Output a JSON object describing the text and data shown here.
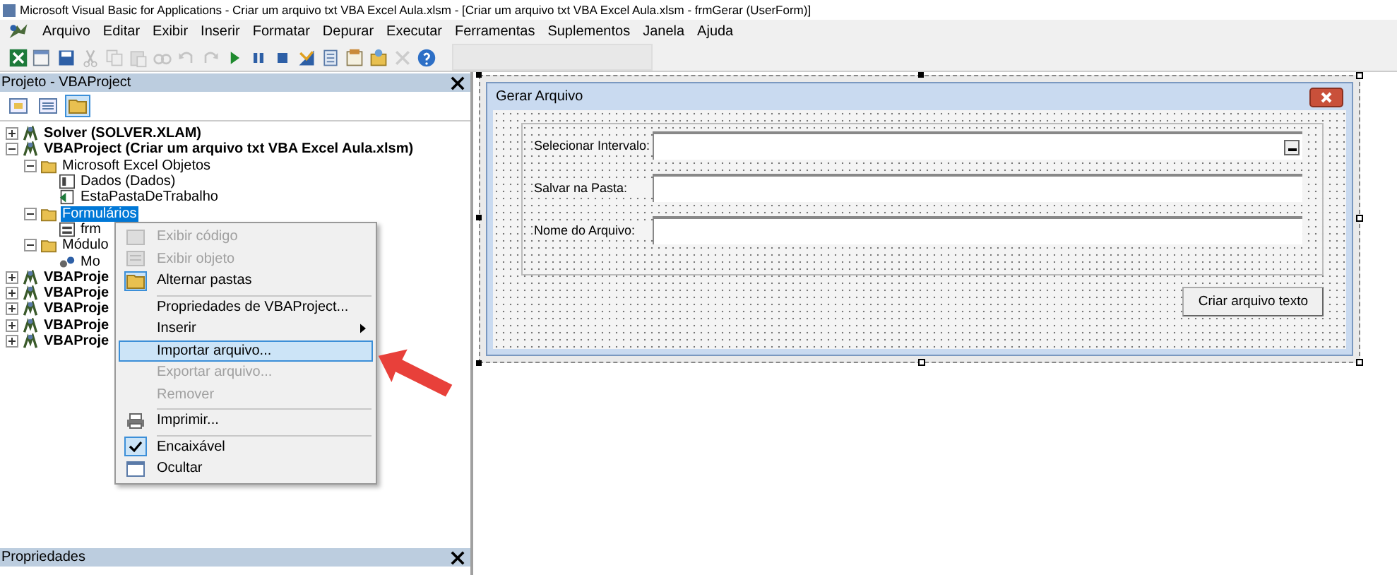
{
  "window": {
    "title": "Microsoft Visual Basic for Applications - Criar um arquivo txt VBA Excel Aula.xlsm - [Criar um arquivo txt VBA Excel Aula.xlsm - frmGerar (UserForm)]"
  },
  "menu_bar": [
    "Arquivo",
    "Editar",
    "Exibir",
    "Inserir",
    "Formatar",
    "Depurar",
    "Executar",
    "Ferramentas",
    "Suplementos",
    "Janela",
    "Ajuda"
  ],
  "toolbar": [
    {
      "kind": "excel",
      "disabled": false
    },
    {
      "kind": "insert",
      "disabled": false
    },
    {
      "kind": "save",
      "disabled": false
    },
    {
      "kind": "cut",
      "disabled": true
    },
    {
      "kind": "copy",
      "disabled": true
    },
    {
      "kind": "paste",
      "disabled": true
    },
    {
      "kind": "find",
      "disabled": true
    },
    {
      "kind": "undo",
      "disabled": true
    },
    {
      "kind": "redo",
      "disabled": true
    },
    {
      "kind": "run",
      "disabled": false
    },
    {
      "kind": "pause",
      "disabled": false
    },
    {
      "kind": "stop",
      "disabled": false
    },
    {
      "kind": "design",
      "disabled": false
    },
    {
      "kind": "explorer",
      "disabled": false
    },
    {
      "kind": "properties",
      "disabled": false
    },
    {
      "kind": "browser",
      "disabled": false
    },
    {
      "kind": "toolbox",
      "disabled": true
    },
    {
      "kind": "help",
      "disabled": false
    }
  ],
  "project_panel": {
    "title": "Projeto - VBAProject",
    "toolbar": [
      {
        "kind": "code",
        "selected": false
      },
      {
        "kind": "object",
        "selected": false
      },
      {
        "kind": "folders",
        "selected": true
      }
    ],
    "tree": [
      {
        "label": "Solver (SOLVER.XLAM)",
        "kind": "project",
        "expanded": false,
        "selected": false
      },
      {
        "label": "VBAProject (Criar um arquivo txt VBA Excel Aula.xlsm)",
        "kind": "project",
        "expanded": true,
        "selected": false,
        "children": [
          {
            "label": "Microsoft Excel Objetos",
            "kind": "folder",
            "expanded": true,
            "selected": false,
            "children": [
              {
                "label": "Dados (Dados)",
                "kind": "sheet",
                "selected": false
              },
              {
                "label": "EstaPastaDeTrabalho",
                "kind": "workbook",
                "selected": false
              }
            ]
          },
          {
            "label": "Formulários",
            "kind": "folder",
            "expanded": true,
            "selected": true,
            "children": [
              {
                "label": "frm",
                "kind": "form",
                "selected": false
              }
            ]
          },
          {
            "label": "Módulo",
            "kind": "folder",
            "expanded": true,
            "selected": false,
            "children": [
              {
                "label": "Mo",
                "kind": "module",
                "selected": false
              }
            ]
          }
        ]
      },
      {
        "label": "VBAProje",
        "kind": "project",
        "expanded": false,
        "selected": false
      },
      {
        "label": "VBAProje",
        "kind": "project",
        "expanded": false,
        "selected": false
      },
      {
        "label": "VBAProje",
        "kind": "project",
        "expanded": false,
        "selected": false
      },
      {
        "label": "VBAProje",
        "kind": "project",
        "expanded": false,
        "selected": false
      },
      {
        "label": "VBAProje",
        "kind": "project",
        "expanded": false,
        "selected": false
      }
    ]
  },
  "context_menu": [
    {
      "label": "Exibir código",
      "kind": "code",
      "disabled": true,
      "checked": false,
      "selected": false,
      "separator_before": false,
      "submenu": false
    },
    {
      "label": "Exibir objeto",
      "kind": "object",
      "disabled": true,
      "checked": false,
      "selected": false,
      "separator_before": false,
      "submenu": false
    },
    {
      "label": "Alternar pastas",
      "kind": "folder",
      "disabled": false,
      "checked": true,
      "selected": false,
      "separator_before": false,
      "submenu": false
    },
    {
      "label": "Propriedades de VBAProject...",
      "kind": "plain",
      "disabled": false,
      "checked": false,
      "selected": false,
      "separator_before": true,
      "submenu": false
    },
    {
      "label": "Inserir",
      "kind": "plain",
      "disabled": false,
      "checked": false,
      "selected": false,
      "separator_before": false,
      "submenu": true
    },
    {
      "label": "Importar arquivo...",
      "kind": "plain",
      "disabled": false,
      "checked": false,
      "selected": true,
      "separator_before": false,
      "submenu": false
    },
    {
      "label": "Exportar arquivo...",
      "kind": "plain",
      "disabled": true,
      "checked": false,
      "selected": false,
      "separator_before": false,
      "submenu": false
    },
    {
      "label": "Remover",
      "kind": "plain",
      "disabled": true,
      "checked": false,
      "selected": false,
      "separator_before": false,
      "submenu": false
    },
    {
      "label": "Imprimir...",
      "kind": "printer",
      "disabled": false,
      "checked": false,
      "selected": false,
      "separator_before": true,
      "submenu": false
    },
    {
      "label": "Encaixável",
      "kind": "plain",
      "disabled": false,
      "checked": true,
      "selected": false,
      "separator_before": true,
      "submenu": false
    },
    {
      "label": "Ocultar",
      "kind": "window",
      "disabled": false,
      "checked": false,
      "selected": false,
      "separator_before": false,
      "submenu": false
    }
  ],
  "properties_panel": {
    "title": "Propriedades"
  },
  "user_form": {
    "title": "Gerar Arquivo",
    "fields": [
      {
        "label": "Selecionar Intervalo:",
        "kind": "refedit"
      },
      {
        "label": "Salvar na Pasta:",
        "kind": "textbox"
      },
      {
        "label": "Nome do Arquivo:",
        "kind": "textbox"
      }
    ],
    "button": "Criar arquivo texto"
  }
}
